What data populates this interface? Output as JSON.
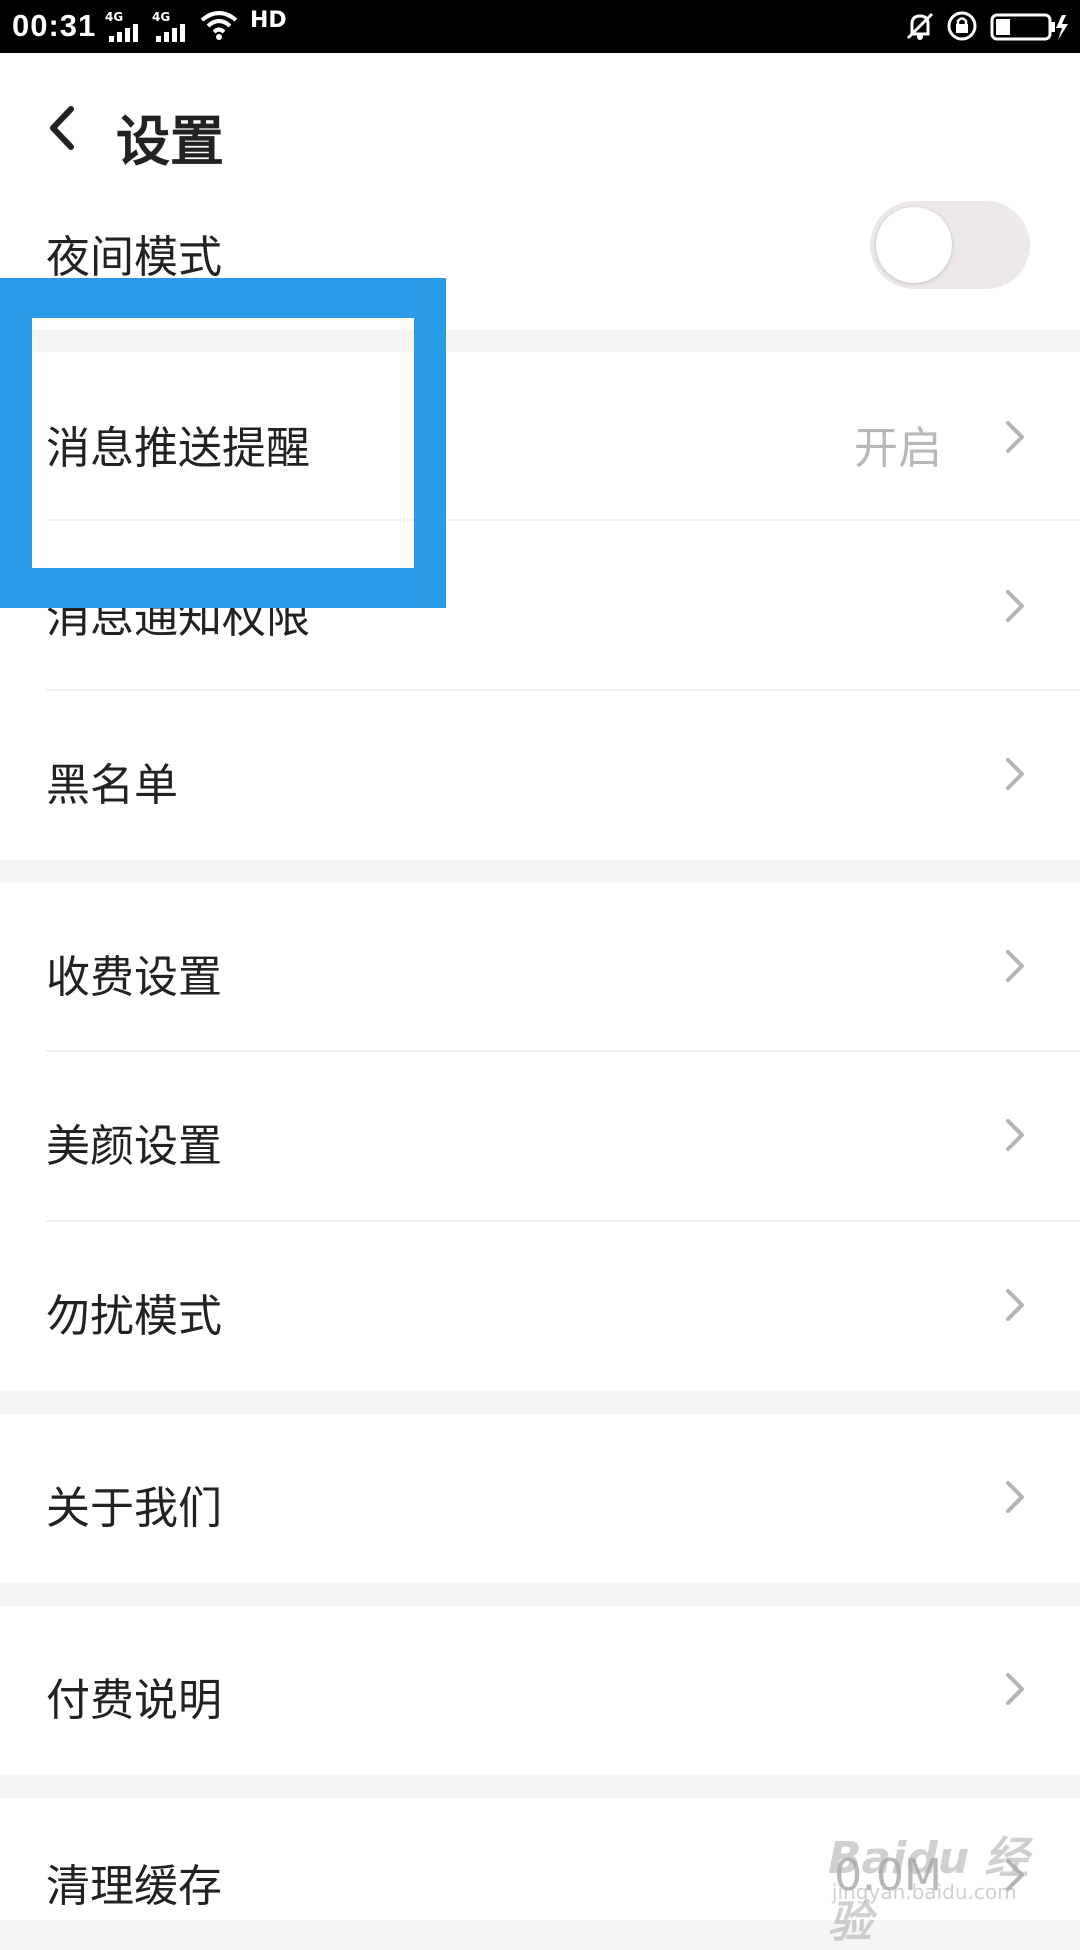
{
  "status_bar": {
    "time": "00:31",
    "network_1": "4G",
    "network_2": "4G",
    "hd_badge": "HD",
    "icons": [
      "signal-icon",
      "wifi-icon",
      "mute-bell-icon",
      "rotation-lock-icon",
      "battery-charging-icon"
    ]
  },
  "header": {
    "title": "设置",
    "back_icon": "back-chevron-icon"
  },
  "settings": {
    "night_mode": {
      "label": "夜间模式",
      "enabled": false
    },
    "push_reminder": {
      "label": "消息推送提醒",
      "value": "开启"
    },
    "notification_permission": {
      "label": "消息通知权限"
    },
    "blacklist": {
      "label": "黑名单"
    },
    "charge_settings": {
      "label": "收费设置"
    },
    "beauty_settings": {
      "label": "美颜设置"
    },
    "dnd_mode": {
      "label": "勿扰模式"
    },
    "about_us": {
      "label": "关于我们"
    },
    "payment_info": {
      "label": "付费说明"
    },
    "clear_cache": {
      "label": "清理缓存",
      "value": "0.0M"
    }
  },
  "watermark": {
    "text": "Baidu 经验",
    "sub": "jingyan.baidu.com"
  },
  "colors": {
    "highlight": "#2b9be8",
    "background": "#f5f5f7",
    "value_text": "#b8b8b8"
  }
}
